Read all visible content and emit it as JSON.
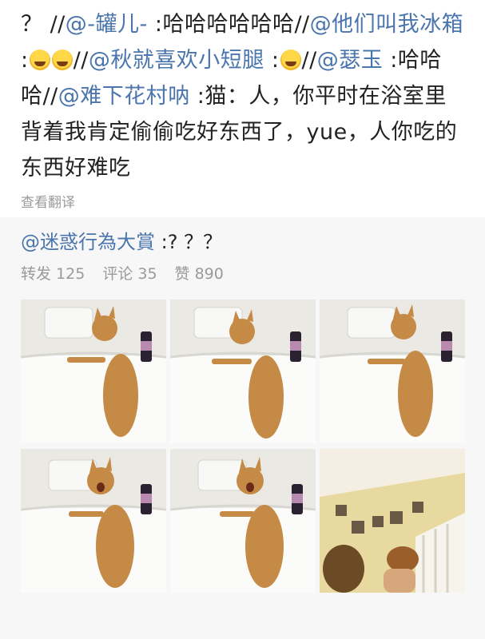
{
  "post": {
    "seg1": "？ //",
    "m1": "@-罐儿-",
    "seg2": " :哈哈哈哈哈哈//",
    "m2": "@他们叫我冰箱",
    "seg3": " :",
    "seg4": "//",
    "m3": "@秋就喜欢小短腿",
    "seg5": " :",
    "seg6": "//",
    "m4": "@瑟玉",
    "seg7": " :哈哈哈//",
    "m5": "@难下花村呐",
    "seg8": " :猫：人，你平时在浴室里背着我肯定偷偷吃好东西了，yue，人你吃的东西好难吃",
    "emoji_name": "laugh-cry-emoji",
    "translate_link": "查看翻译"
  },
  "repost": {
    "mention": "@迷惑行為大賞",
    "text": " :? ？？",
    "stats": {
      "repost": "转发 125",
      "comment": "评论 35",
      "like": "赞 890"
    }
  },
  "colors": {
    "mention": "#4a75ad",
    "muted": "#9a9a9a",
    "repost_bg": "#f7f7f7"
  }
}
